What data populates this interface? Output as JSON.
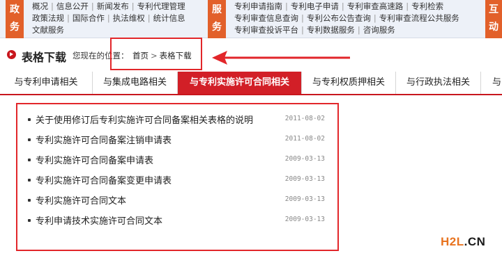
{
  "topnav": {
    "categories": [
      {
        "chars": [
          "政",
          "务"
        ]
      },
      {
        "chars": [
          "服",
          "务"
        ]
      },
      {
        "chars": [
          "互",
          "动"
        ]
      }
    ],
    "gov_links": [
      [
        "概况",
        "信息公开",
        "新闻发布",
        "专利代理管理"
      ],
      [
        "政策法规",
        "国际合作",
        "执法维权",
        "统计信息"
      ],
      [
        "文献服务"
      ]
    ],
    "service_links": [
      [
        "专利申请指南",
        "专利电子申请",
        "专利审查高速路",
        "专利检索"
      ],
      [
        "专利审查信息查询",
        "专利公布公告查询",
        "专利审查流程公共服务"
      ],
      [
        "专利审查投诉平台",
        "专利数据服务",
        "咨询服务"
      ]
    ]
  },
  "header": {
    "title": "表格下载",
    "location_label": "您现在的位置：",
    "breadcrumb": [
      "首页",
      "表格下载"
    ]
  },
  "tabs": [
    {
      "label": "与专利申请相关",
      "active": false
    },
    {
      "label": "与集成电路相关",
      "active": false
    },
    {
      "label": "与专利实施许可合同相关",
      "active": true
    },
    {
      "label": "与专利权质押相关",
      "active": false
    },
    {
      "label": "与行政执法相关",
      "active": false
    },
    {
      "label": "与",
      "active": false
    }
  ],
  "documents": [
    {
      "title": "关于使用修订后专利实施许可合同备案相关表格的说明",
      "date": "2011-08-02"
    },
    {
      "title": "专利实施许可合同备案注销申请表",
      "date": "2011-08-02"
    },
    {
      "title": "专利实施许可合同备案申请表",
      "date": "2009-03-13"
    },
    {
      "title": "专利实施许可合同备案变更申请表",
      "date": "2009-03-13"
    },
    {
      "title": "专利实施许可合同文本",
      "date": "2009-03-13"
    },
    {
      "title": "专利申请技术实施许可合同文本",
      "date": "2009-03-13"
    }
  ],
  "watermark": {
    "part1": "H2L",
    "part2": ".CN"
  },
  "colors": {
    "accent_red": "#d21f27",
    "annotation_red": "#e2262a",
    "nav_orange": "#e2602a",
    "nav_bg": "#edf1f8"
  }
}
